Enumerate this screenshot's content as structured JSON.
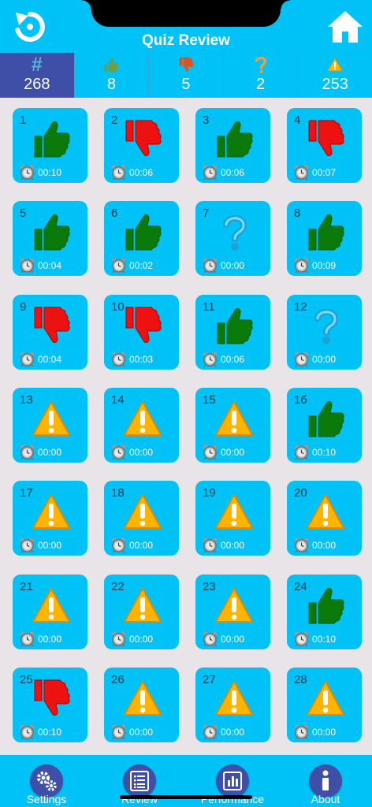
{
  "header": {
    "title": "Quiz Review"
  },
  "stats": [
    {
      "key": "total",
      "icon": "hash-icon",
      "symbol": "#",
      "value": "268"
    },
    {
      "key": "correct",
      "icon": "thumbs-up-icon",
      "value": "8"
    },
    {
      "key": "wrong",
      "icon": "thumbs-down-icon",
      "value": "5"
    },
    {
      "key": "skipped",
      "icon": "question-icon",
      "value": "2"
    },
    {
      "key": "unanswered",
      "icon": "warning-icon",
      "value": "253"
    }
  ],
  "tiles": [
    {
      "num": "1",
      "status": "up",
      "time": "00:10"
    },
    {
      "num": "2",
      "status": "down",
      "time": "00:06"
    },
    {
      "num": "3",
      "status": "up",
      "time": "00:06"
    },
    {
      "num": "4",
      "status": "down",
      "time": "00:07"
    },
    {
      "num": "5",
      "status": "up",
      "time": "00:04"
    },
    {
      "num": "6",
      "status": "up",
      "time": "00:02"
    },
    {
      "num": "7",
      "status": "question",
      "time": "00:00"
    },
    {
      "num": "8",
      "status": "up",
      "time": "00:09"
    },
    {
      "num": "9",
      "status": "down",
      "time": "00:04"
    },
    {
      "num": "10",
      "status": "down",
      "time": "00:03"
    },
    {
      "num": "11",
      "status": "up",
      "time": "00:06"
    },
    {
      "num": "12",
      "status": "question",
      "time": "00:00"
    },
    {
      "num": "13",
      "status": "warning",
      "time": "00:00"
    },
    {
      "num": "14",
      "status": "warning",
      "time": "00:00"
    },
    {
      "num": "15",
      "status": "warning",
      "time": "00:00"
    },
    {
      "num": "16",
      "status": "up",
      "time": "00:10"
    },
    {
      "num": "17",
      "status": "warning",
      "time": "00:00"
    },
    {
      "num": "18",
      "status": "warning",
      "time": "00:00"
    },
    {
      "num": "19",
      "status": "warning",
      "time": "00:00"
    },
    {
      "num": "20",
      "status": "warning",
      "time": "00:00"
    },
    {
      "num": "21",
      "status": "warning",
      "time": "00:00"
    },
    {
      "num": "22",
      "status": "warning",
      "time": "00:00"
    },
    {
      "num": "23",
      "status": "warning",
      "time": "00:00"
    },
    {
      "num": "24",
      "status": "up",
      "time": "00:10"
    },
    {
      "num": "25",
      "status": "down",
      "time": "00:10"
    },
    {
      "num": "26",
      "status": "warning",
      "time": "00:00"
    },
    {
      "num": "27",
      "status": "warning",
      "time": "00:00"
    },
    {
      "num": "28",
      "status": "warning",
      "time": "00:00"
    }
  ],
  "tabs": [
    {
      "key": "settings",
      "icon": "gears-icon",
      "label": "Settings"
    },
    {
      "key": "review",
      "icon": "list-icon",
      "label": "Review"
    },
    {
      "key": "performance",
      "icon": "bar-chart-icon",
      "label": "Performance"
    },
    {
      "key": "about",
      "icon": "info-icon",
      "label": "About"
    }
  ],
  "colors": {
    "accent": "#00c2f7",
    "navy": "#3f4ea6",
    "correct": "#0a7a0a",
    "wrong": "#ee1111",
    "warning": "#ffb400",
    "question": "#1aa3d6"
  }
}
